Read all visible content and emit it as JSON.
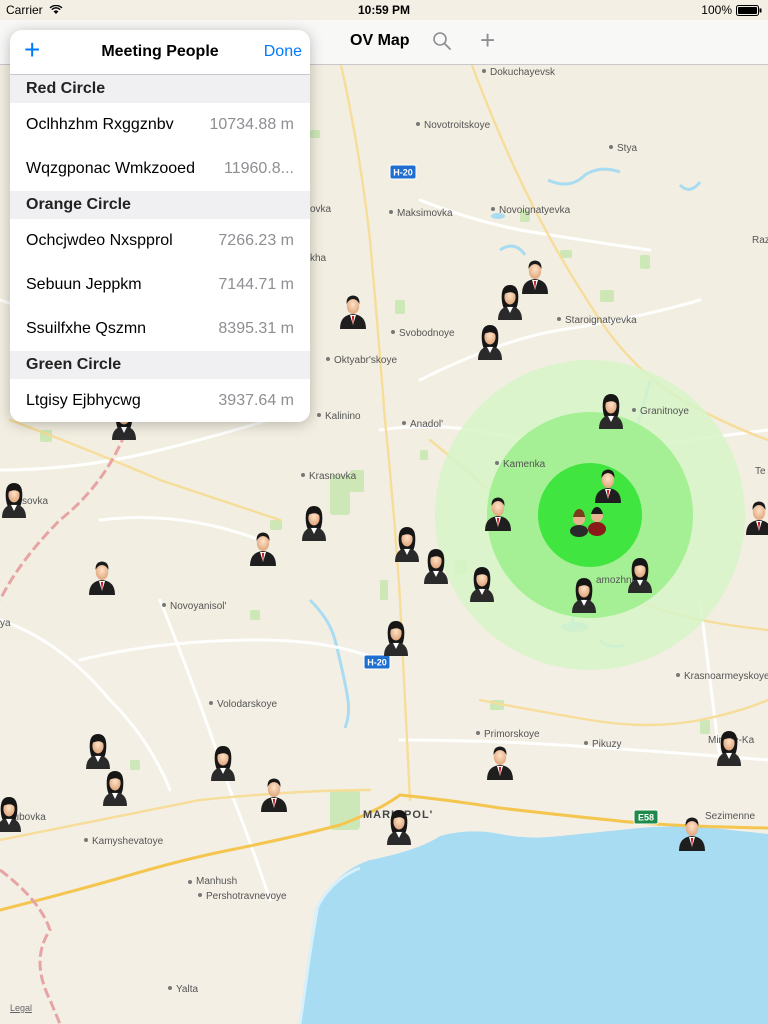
{
  "status_bar": {
    "carrier": "Carrier",
    "time": "10:59 PM",
    "battery": "100%"
  },
  "nav_bar": {
    "title": "OV Map",
    "search_icon": "search-icon",
    "add_icon": "plus-icon"
  },
  "popover": {
    "title": "Meeting People",
    "add_icon": "plus-icon",
    "done_label": "Done",
    "sections": [
      {
        "name": "Red Circle",
        "rows": [
          {
            "name": "Oclhhzhm Rxggznbv",
            "distance": "10734.88 m"
          },
          {
            "name": "Wqzgponac Wmkzooed",
            "distance": "11960.8..."
          }
        ]
      },
      {
        "name": "Orange Circle",
        "rows": [
          {
            "name": "Ochcjwdeo Nxspprol",
            "distance": "7266.23 m"
          },
          {
            "name": "Sebuun Jeppkm",
            "distance": "7144.71 m"
          },
          {
            "name": "Ssuilfxhe Qszmn",
            "distance": "8395.31 m"
          }
        ]
      },
      {
        "name": "Green Circle",
        "rows": [
          {
            "name": "Ltgisy Ejbhycwg",
            "distance": "3937.64 m"
          }
        ]
      }
    ]
  },
  "map": {
    "legal": "Legal",
    "colors": {
      "land": "#f3efe4",
      "water": "#a8dcf3",
      "park": "#c9e7b3",
      "circle_outer": "#d7f5c8",
      "circle_mid": "#9ef08e",
      "circle_inner": "#3be43b",
      "highway": "#f4c64f"
    },
    "place_labels": {
      "dokuchayevsk": "Dokuchayevsk",
      "novotroitskoye": "Novotroitskoye",
      "stya": "Stya",
      "novoignatyevka": "Novoignatyevka",
      "maksimovka": "Maksimovka",
      "staroignatyevka": "Staroignatyevka",
      "svobodnoye": "Svobodnoye",
      "oktyabrskoye": "Oktyabr'skoye",
      "granitnoye": "Granitnoye",
      "kalinino": "Kalinino",
      "anadol": "Anadol'",
      "kamenka": "Kamenka",
      "krasnovka": "Krasnovka",
      "novoyanisol": "Novoyanisol'",
      "krasnoarmeyskoye": "Krasnoarmeyskoye",
      "volodarskoye": "Volodarskoye",
      "primorskoye": "Primorskoye",
      "pikuzy": "Pikuzy",
      "mariupol": "MARIUPOL'",
      "sezimenne": "Sezimenne",
      "mirnoe": "Mirnoe-Ka",
      "dubovka": "dubovka",
      "kamyshevatoye": "Kamyshevatoye",
      "manhush": "Manhush",
      "pershotravnevoye": "Pershotravnevoye",
      "yalta": "Yalta",
      "ovka": "ovka",
      "kha": "kha",
      "sovka": "sovka",
      "ya": "ya",
      "raz": "Raz",
      "te": "Te",
      "amozhnoe": "amozhnoe"
    },
    "road_shields": {
      "h20_top": "H-20",
      "h20_bottom": "H-20",
      "e58": "E58"
    },
    "markers": {
      "male": "male-person-icon",
      "female": "female-person-icon",
      "group": "meeting-group-icon"
    }
  }
}
